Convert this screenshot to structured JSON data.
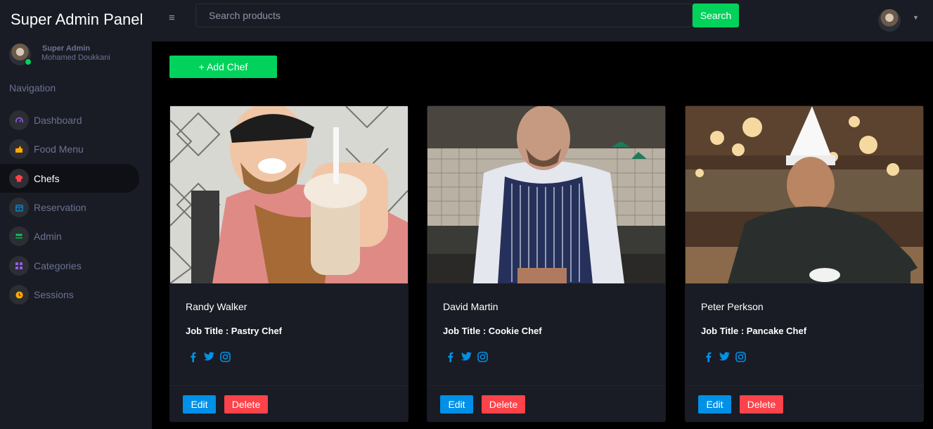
{
  "app": {
    "title": "Super Admin Panel"
  },
  "profile": {
    "role": "Super Admin",
    "name": "Mohamed Doukkani"
  },
  "navigation": {
    "heading": "Navigation",
    "items": [
      {
        "label": "Dashboard",
        "icon": "speedometer-icon",
        "color": "#8f5fe8",
        "active": false
      },
      {
        "label": "Food Menu",
        "icon": "food-icon",
        "color": "#ffab00",
        "active": false
      },
      {
        "label": "Chefs",
        "icon": "chef-hat-icon",
        "color": "#fc424a",
        "active": true
      },
      {
        "label": "Reservation",
        "icon": "calendar-icon",
        "color": "#0090e7",
        "active": false
      },
      {
        "label": "Admin",
        "icon": "users-icon",
        "color": "#00d25b",
        "active": false
      },
      {
        "label": "Categories",
        "icon": "grid-icon",
        "color": "#8f5fe8",
        "active": false
      },
      {
        "label": "Sessions",
        "icon": "clock-icon",
        "color": "#ffab00",
        "active": false
      }
    ]
  },
  "topbar": {
    "search_placeholder": "Search products",
    "search_button": "Search"
  },
  "main": {
    "add_button": "+ Add Chef"
  },
  "chefs": [
    {
      "name": "Randy Walker",
      "job": "Job Title : Pastry Chef"
    },
    {
      "name": "David Martin",
      "job": "Job Title : Cookie Chef"
    },
    {
      "name": "Peter Perkson",
      "job": "Job Title : Pancake Chef"
    }
  ],
  "card_actions": {
    "edit": "Edit",
    "delete": "Delete"
  },
  "colors": {
    "accent_green": "#00d25b",
    "edit_blue": "#0090e7",
    "delete_red": "#fc424a",
    "panel_bg": "#191c24",
    "social_blue": "#0090e7"
  }
}
